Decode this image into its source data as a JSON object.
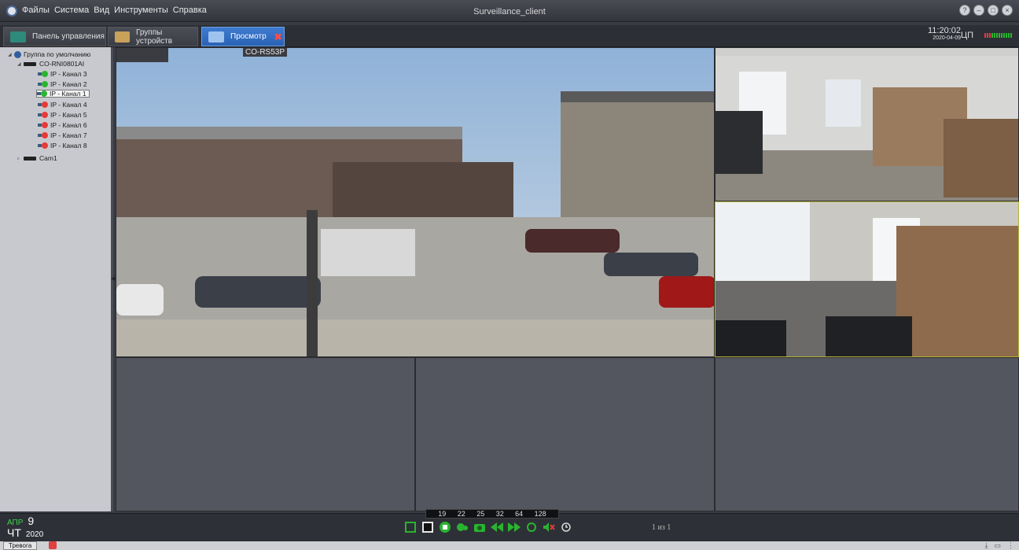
{
  "window": {
    "title": "Surveillance_client",
    "menu": [
      "Файлы",
      "Система",
      "Вид",
      "Инструменты",
      "Справка"
    ],
    "buttons": [
      "?",
      "–",
      "□",
      "×"
    ]
  },
  "tabs": [
    {
      "label": "Панель управления",
      "icon": "dashboard-icon"
    },
    {
      "label": "Группы устройств",
      "icon": "device-group-icon"
    },
    {
      "label": "Просмотр",
      "icon": "monitor-icon",
      "active": true
    }
  ],
  "status": {
    "time": "11:20:02",
    "date": "2020-04-09",
    "cpu_label": "ЦП"
  },
  "tree": {
    "group": "Группа по умолчанию",
    "devices": [
      {
        "name": "CO-RNI0801AI",
        "channels": [
          {
            "label": "IP - Канал 3",
            "status": "online"
          },
          {
            "label": "IP - Канал 2",
            "status": "online"
          },
          {
            "label": "IP - Канал 1",
            "status": "online",
            "selected": true
          },
          {
            "label": "IP - Канал 4",
            "status": "offline"
          },
          {
            "label": "IP - Канал 5",
            "status": "offline"
          },
          {
            "label": "IP - Канал 6",
            "status": "offline"
          },
          {
            "label": "IP - Канал 7",
            "status": "offline"
          },
          {
            "label": "IP - Канал 8",
            "status": "offline"
          }
        ]
      },
      {
        "name": "Cam1",
        "channels": []
      }
    ]
  },
  "video": {
    "main_label": "CO-RS53P",
    "zoom_levels": [
      "19",
      "22",
      "25",
      "32",
      "64",
      "128"
    ],
    "page_info": "1 из 1"
  },
  "calendar": {
    "month": "АПР",
    "day": "9",
    "weekday": "ЧТ",
    "year": "2020"
  },
  "footer": {
    "alarm_tab": "Тревога"
  },
  "colors": {
    "accent": "#2a62b4",
    "online": "#2ab430",
    "offline": "#e53a3a",
    "month_green": "#39d44a"
  }
}
